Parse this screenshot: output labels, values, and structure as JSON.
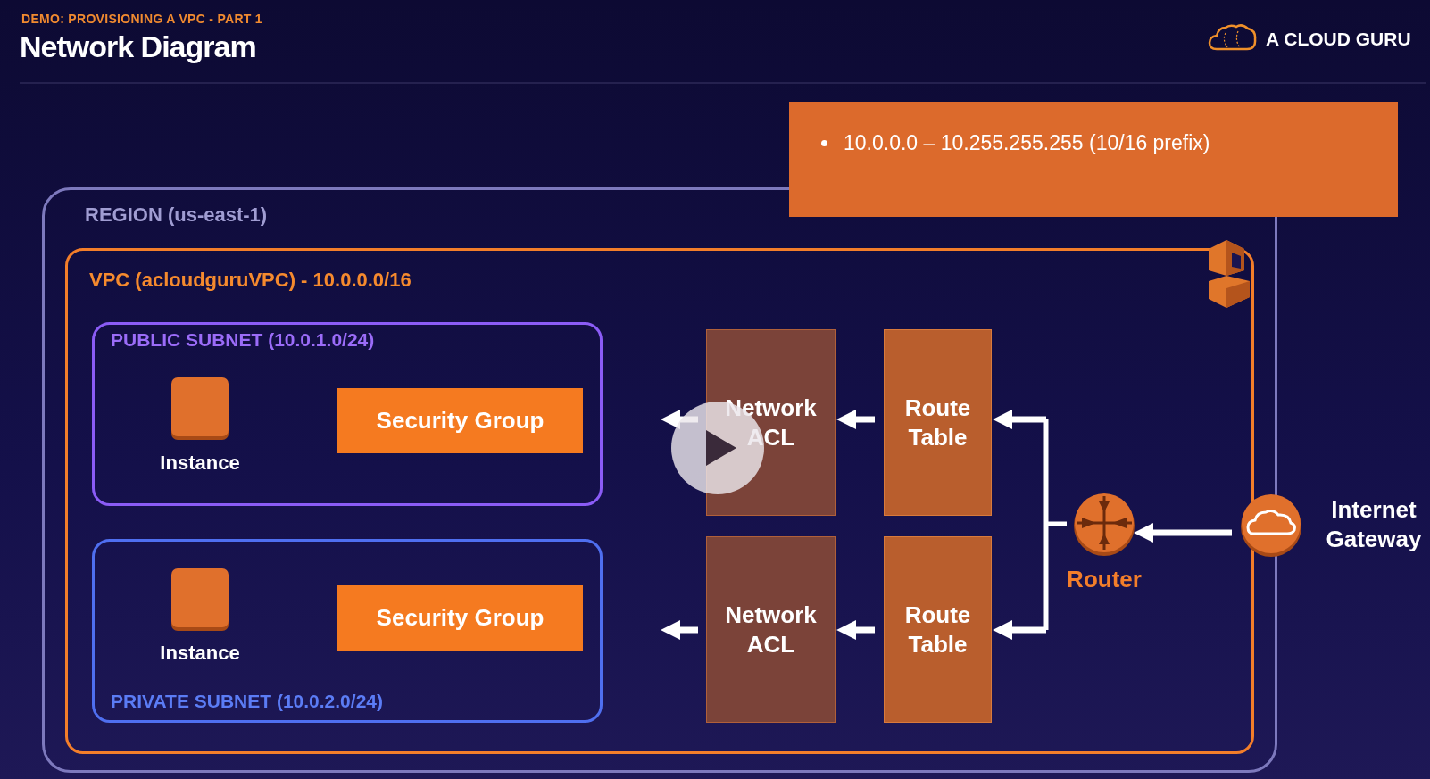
{
  "header": {
    "subtitle": "DEMO: PROVISIONING A VPC - PART 1",
    "title": "Network Diagram"
  },
  "logo": {
    "text": "A CLOUD GURU"
  },
  "callout": {
    "bullets": [
      "10.0.0.0 – 10.255.255.255 (10/16 prefix)"
    ]
  },
  "region": {
    "label": "REGION (us-east-1)"
  },
  "vpc": {
    "label": "VPC (acloudguruVPC) - 10.0.0.0/16"
  },
  "subnets": [
    {
      "kind": "public",
      "label": "PUBLIC SUBNET (10.0.1.0/24)",
      "instance": "Instance",
      "security_group": "Security Group"
    },
    {
      "kind": "private",
      "label": "PRIVATE SUBNET (10.0.2.0/24)",
      "instance": "Instance",
      "security_group": "Security Group"
    }
  ],
  "network_acls": [
    "Network ACL",
    "Network ACL"
  ],
  "route_tables": [
    "Route Table",
    "Route Table"
  ],
  "router": {
    "label": "Router"
  },
  "gateway": {
    "label": "Internet Gateway"
  }
}
